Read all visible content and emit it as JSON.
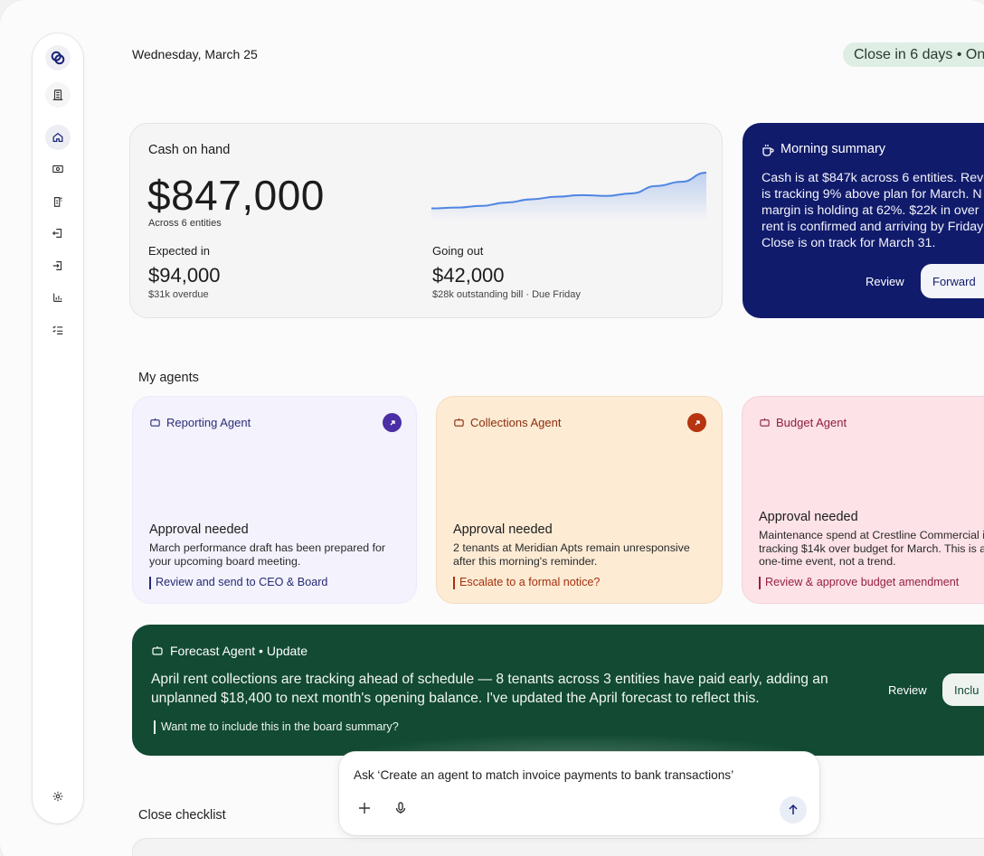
{
  "header": {
    "date": "Wednesday, March 25",
    "close_status": "Close in 6 days  •  On"
  },
  "sidebar": {
    "items": [
      {
        "name": "logo"
      },
      {
        "name": "documents"
      },
      {
        "name": "home",
        "active": true
      },
      {
        "name": "cash"
      },
      {
        "name": "invoices"
      },
      {
        "name": "outgoing"
      },
      {
        "name": "incoming"
      },
      {
        "name": "reports"
      },
      {
        "name": "checklist"
      },
      {
        "name": "settings"
      }
    ]
  },
  "cash_card": {
    "label": "Cash on hand",
    "amount": "$847,000",
    "entities": "Across 6 entities",
    "expected_label": "Expected in",
    "expected_value": "$94,000",
    "expected_sub": "$31k overdue",
    "out_label": "Going out",
    "out_value": "$42,000",
    "out_sub": "$28k outstanding bill · Due Friday",
    "trend": [
      0.14,
      0.16,
      0.2,
      0.28,
      0.36,
      0.42,
      0.46,
      0.44,
      0.5,
      0.68,
      0.78,
      1.0
    ]
  },
  "summary": {
    "title": "Morning summary",
    "body": "Cash is at $847k across 6 entities. Reve\nis tracking 9% above plan for March. N\nmargin is holding at 62%. $22k in over\nrent is confirmed and arriving by Friday\nClose is on track for March 31.",
    "review": "Review",
    "forward": "Forward"
  },
  "agents_section": {
    "title": "My agents",
    "agents": [
      {
        "name": "Reporting Agent",
        "status": "Approval needed",
        "body": "March performance draft has been prepared for\nyour upcoming board meeting.",
        "action": "Review and send to CEO & Board"
      },
      {
        "name": "Collections Agent",
        "status": "Approval needed",
        "body": "2 tenants at Meridian Apts remain unresponsive\nafter this morning's reminder.",
        "action": "Escalate to a formal notice?"
      },
      {
        "name": "Budget Agent",
        "status": "Approval needed",
        "body": "Maintenance spend at Crestline Commercial i\ntracking $14k over budget for March. This is a\none-time event, not a trend.",
        "action": "Review & approve budget amendment"
      }
    ]
  },
  "forecast": {
    "title": "Forecast Agent  •  Update",
    "body": "April rent collections are tracking ahead of schedule — 8 tenants across 3 entities have paid early, adding an\nunplanned $18,400 to next month's opening balance. I've updated the April forecast to reflect this.",
    "question": "Want me to include this in the board summary?",
    "review": "Review",
    "include": "Inclu"
  },
  "composer": {
    "prompt": "Ask ‘Create an agent to match invoice payments to bank transactions’"
  },
  "checklist": {
    "title": "Close checklist"
  },
  "colors": {
    "summary_bg": "#111b6b",
    "forecast_bg": "#124a33",
    "reporting_bg": "#f3f2fd",
    "collections_bg": "#fdebd4",
    "budget_bg": "#fde2e8",
    "pill_bg": "#dfeee4"
  }
}
